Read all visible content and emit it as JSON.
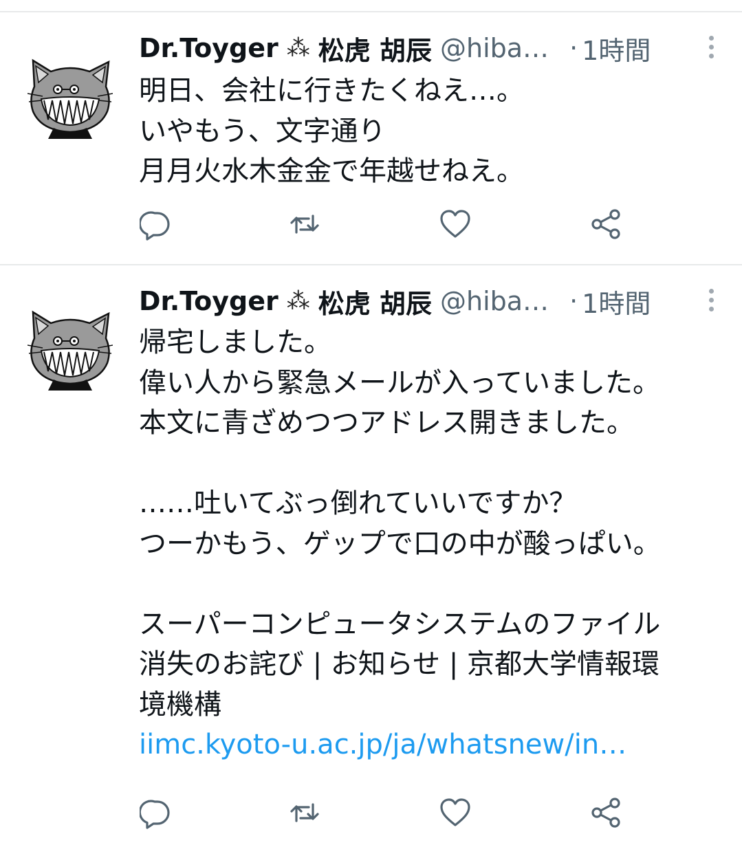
{
  "tweets": [
    {
      "name": "Dr.Toyger",
      "name_symbol": "⁂",
      "name_jp": "松虎 胡辰",
      "handle": "@hiba…",
      "dot": "·",
      "time": "1時間",
      "lines": [
        "明日、会社に行きたくねえ…。",
        "いやもう、文字通り",
        "月月火水木金金で年越せねえ。"
      ]
    },
    {
      "name": "Dr.Toyger",
      "name_symbol": "⁂",
      "name_jp": "松虎 胡辰",
      "handle": "@hiba…",
      "dot": "·",
      "time": "1時間",
      "lines": [
        "帰宅しました。",
        "偉い人から緊急メールが入っていました。",
        "本文に青ざめつつアドレス開きました。",
        "",
        "……吐いてぶっ倒れていいですか？",
        "つーかもう、ゲップで口の中が酸っぱい。",
        "",
        "スーパーコンピュータシステムのファイル",
        "消失のお詫び | お知らせ | 京都大学情報環",
        "境機構"
      ],
      "link": "iimc.kyoto-u.ac.jp/ja/whatsnew/in…"
    }
  ],
  "icons": {
    "reply": "reply-icon",
    "retweet": "retweet-icon",
    "like": "like-icon",
    "share": "share-icon",
    "more": "more-icon",
    "avatar": "cat-avatar-icon"
  },
  "colors": {
    "text": "#0f1419",
    "secondary": "#536471",
    "link": "#1d9bf0",
    "divider": "#e7e9ea"
  }
}
